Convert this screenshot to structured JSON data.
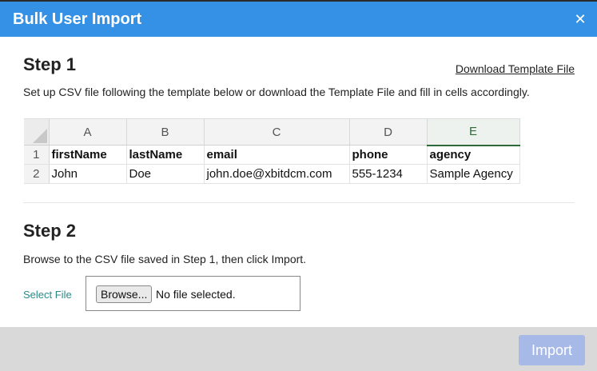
{
  "dialog": {
    "title": "Bulk User Import",
    "close_glyph": "✕"
  },
  "step1": {
    "title": "Step 1",
    "download_link": "Download Template File",
    "description": "Set up CSV file following the template below or download the Template File and fill in cells accordingly."
  },
  "sheet": {
    "columns": [
      "A",
      "B",
      "C",
      "D",
      "E"
    ],
    "selected_column": "E",
    "rows": [
      {
        "num": "1",
        "cells": [
          "firstName",
          "lastName",
          "email",
          "phone",
          "agency"
        ]
      },
      {
        "num": "2",
        "cells": [
          "John",
          "Doe",
          "john.doe@xbitdcm.com",
          "555-1234",
          "Sample Agency"
        ]
      }
    ]
  },
  "step2": {
    "title": "Step 2",
    "description": "Browse to the CSV file saved in Step 1, then click Import.",
    "select_label": "Select File",
    "browse_label": "Browse...",
    "file_status": "No file selected."
  },
  "footer": {
    "import_label": "Import"
  }
}
